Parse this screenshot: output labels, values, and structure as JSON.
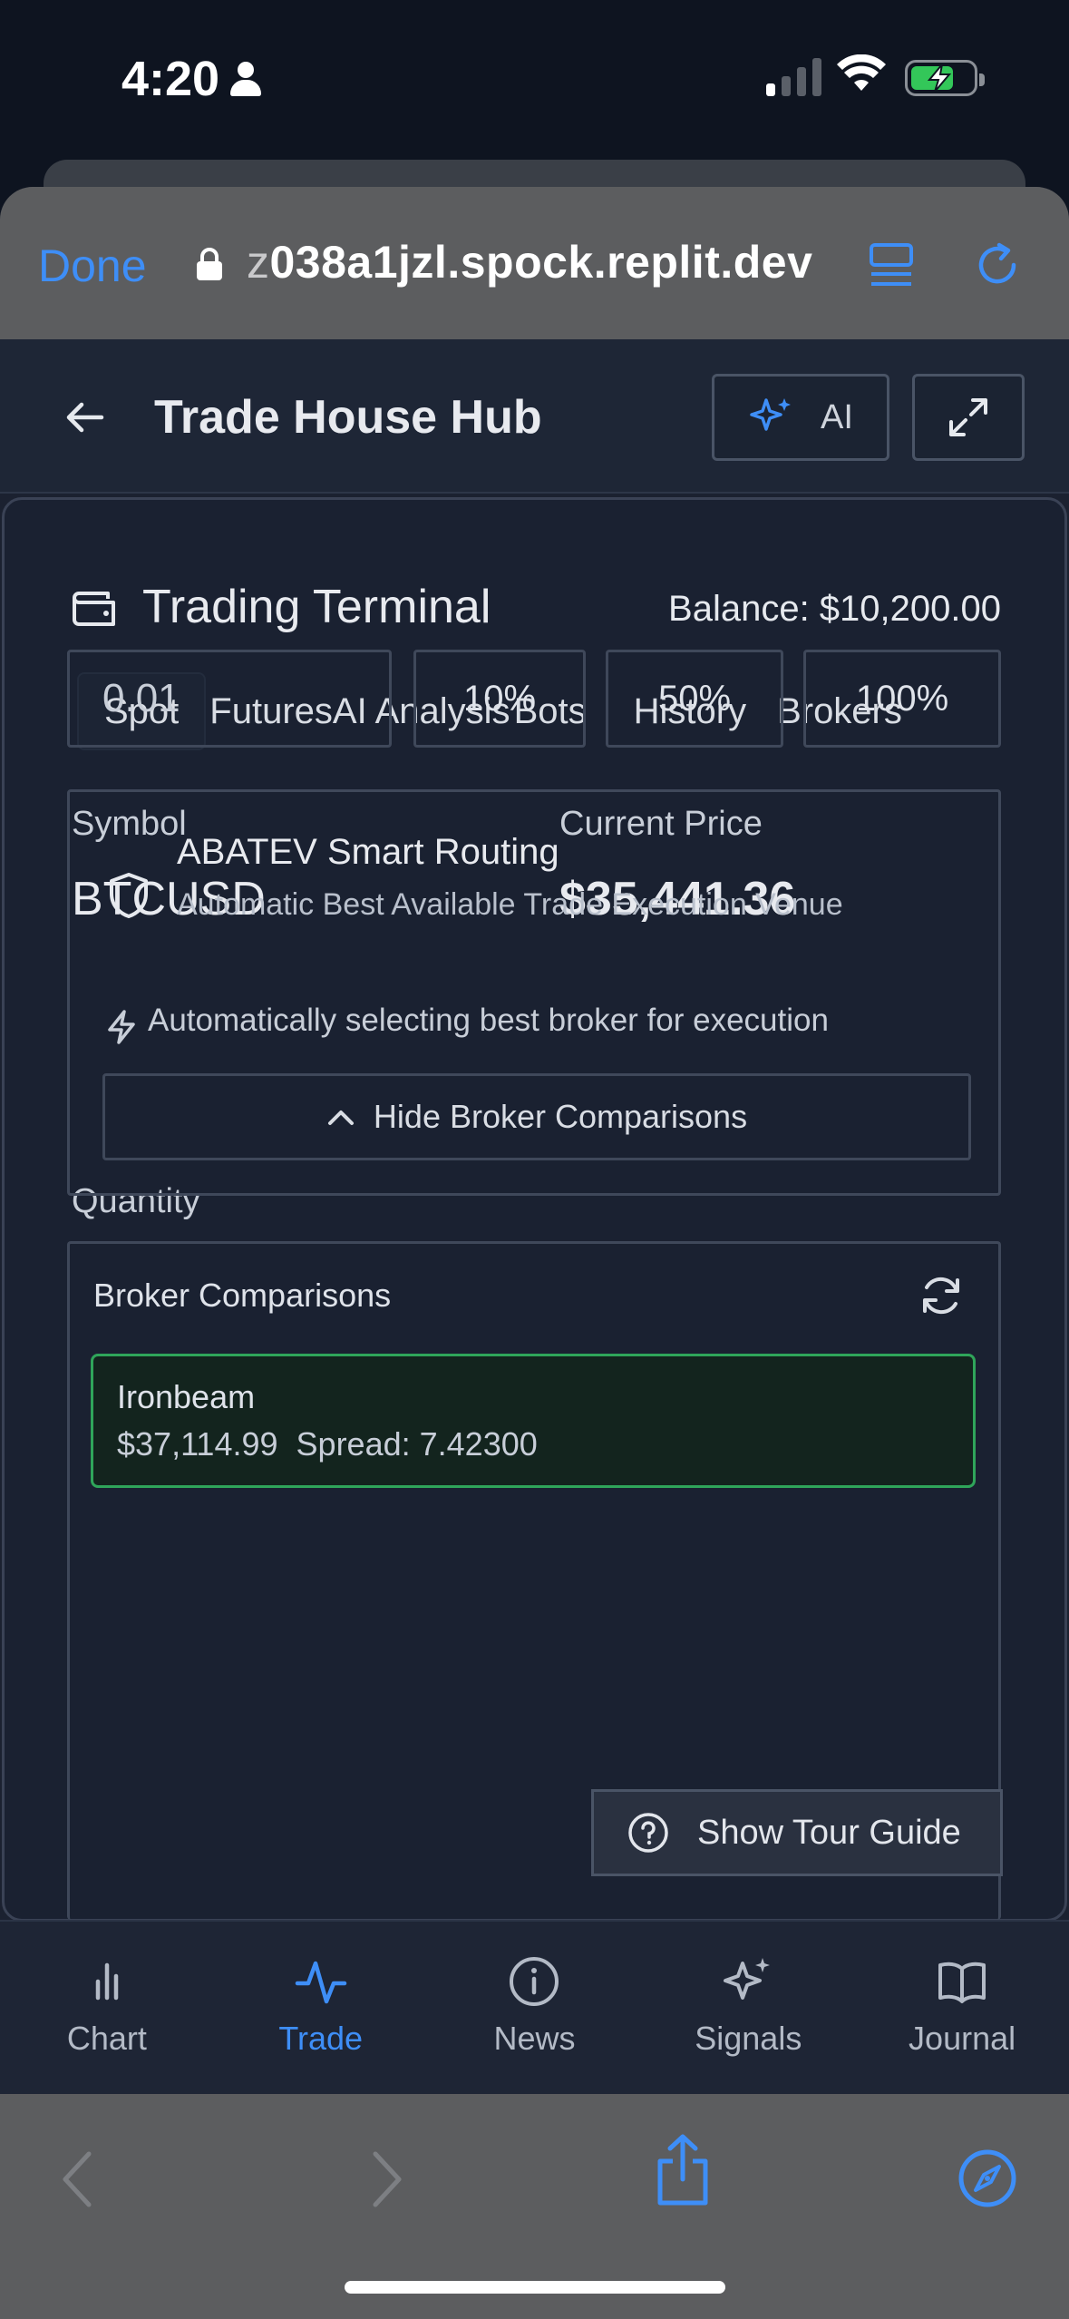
{
  "status_bar": {
    "time": "4:20"
  },
  "browser": {
    "done_label": "Done",
    "url_prefix": "z",
    "url_rest": "038a1jzl.spock.replit.dev"
  },
  "app_bar": {
    "title": "Trade House Hub",
    "ai_label": "AI"
  },
  "terminal": {
    "title": "Trading Terminal",
    "balance": "Balance: $10,200.00",
    "tabs": [
      "Spot",
      "Futures",
      "AI Analysis",
      "Bots",
      "History",
      "Brokers"
    ],
    "symbol_label": "Symbol",
    "symbol_value": "BTCUSD",
    "price_label": "Current Price",
    "price_value": "$35,441.36",
    "quantity_label": "Quantity",
    "quantity_value": "0.01",
    "pct_buttons": [
      "10%",
      "50%",
      "100%"
    ]
  },
  "routing": {
    "title": "ABATEV Smart Routing",
    "subtitle": "Automatic Best Available Trade Execution Venue",
    "auto_text": "Automatically selecting best broker for execution",
    "hide_label": "Hide Broker Comparisons"
  },
  "comparisons": {
    "title": "Broker Comparisons",
    "top_broker": {
      "name": "Ironbeam",
      "price": "$37,114.99",
      "spread": "Spread: 7.42300"
    }
  },
  "tour": {
    "label": "Show Tour Guide"
  },
  "bottom_nav": [
    {
      "label": "Chart",
      "icon": "bar-chart-icon"
    },
    {
      "label": "Trade",
      "icon": "activity-icon",
      "active": true
    },
    {
      "label": "News",
      "icon": "info-icon"
    },
    {
      "label": "Signals",
      "icon": "sparkles-icon"
    },
    {
      "label": "Journal",
      "icon": "book-icon"
    }
  ],
  "colors": {
    "accent": "#3e8ef7",
    "success": "#2fa55a",
    "background": "#1a2131"
  }
}
